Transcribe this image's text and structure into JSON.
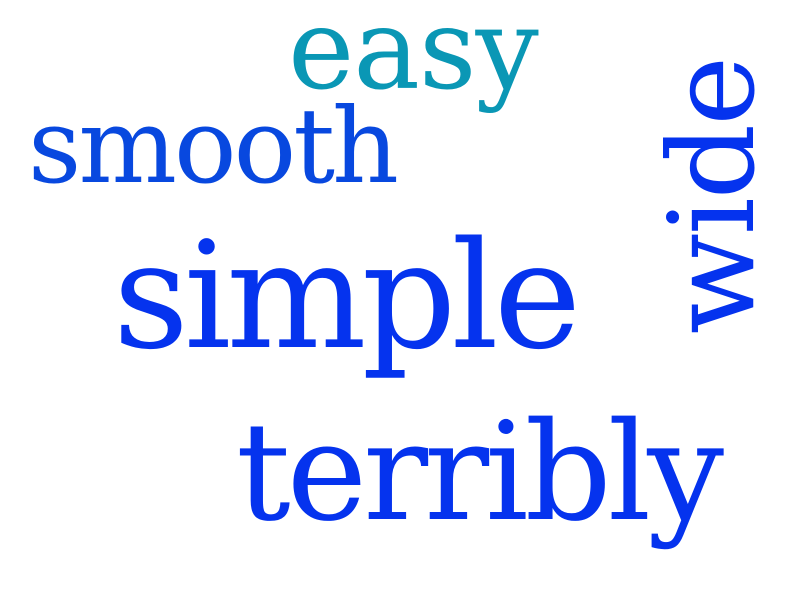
{
  "colors": {
    "background": "#ffffff",
    "teal": "#0a97b5",
    "blue": "#0848df",
    "royal_blue": "#0533ee"
  },
  "words": [
    {
      "id": "easy",
      "text": "easy",
      "color": "#0a97b5",
      "orientation": "horizontal"
    },
    {
      "id": "smooth",
      "text": "smooth",
      "color": "#0848df",
      "orientation": "horizontal"
    },
    {
      "id": "simple",
      "text": "simple",
      "color": "#0533ee",
      "orientation": "horizontal"
    },
    {
      "id": "terribly",
      "text": "terribly",
      "color": "#0533ee",
      "orientation": "horizontal"
    },
    {
      "id": "wide",
      "text": "wide",
      "color": "#0533ee",
      "orientation": "vertical"
    }
  ]
}
